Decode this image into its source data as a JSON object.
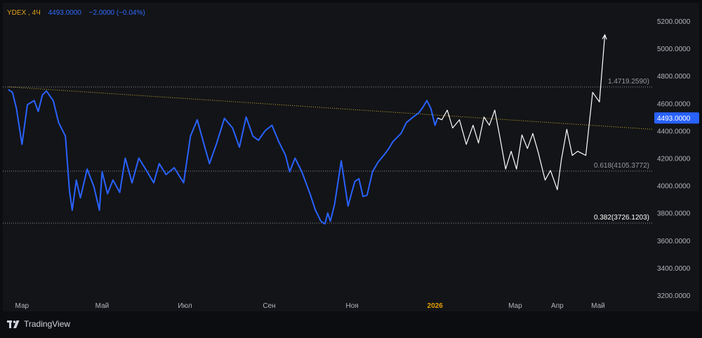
{
  "header": {
    "symbol": "YDEX",
    "timeframe": "4Ч",
    "price": "4493.0000",
    "change": "−2.0000 (−0.04%)"
  },
  "colors": {
    "background": "#0c0d10",
    "plot_background": "#131417",
    "price_line": "#2962ff",
    "projection_line": "#ffffff",
    "trendline": "#c8b632",
    "symbol_text": "#e0a21b",
    "price_text": "#2f6bff",
    "axis_text": "#b2b5be",
    "year_text": "#e5a000",
    "price_tag_bg": "#2962ff"
  },
  "chart_data": {
    "type": "line",
    "title": "",
    "xlabel": "",
    "ylabel": "",
    "ylim": [
      3200,
      5200
    ],
    "y_ticks": [
      "5200.0000",
      "5000.0000",
      "4800.0000",
      "4600.0000",
      "4400.0000",
      "4200.0000",
      "4000.0000",
      "3800.0000",
      "3600.0000",
      "3400.0000",
      "3200.0000"
    ],
    "x_ticks": [
      "Мар",
      "Май",
      "Июл",
      "Сен",
      "Ноя",
      "2026",
      "Мар",
      "Апр",
      "Май"
    ],
    "x_range": [
      "2025-02-20",
      "2026-05-31"
    ],
    "series": [
      {
        "role": "price",
        "x": [
          "2025-02-21",
          "2025-02-24",
          "2025-02-27",
          "2025-03-03",
          "2025-03-07",
          "2025-03-12",
          "2025-03-15",
          "2025-03-18",
          "2025-03-21",
          "2025-03-26",
          "2025-03-30",
          "2025-04-04",
          "2025-04-07",
          "2025-04-09",
          "2025-04-12",
          "2025-04-15",
          "2025-04-20",
          "2025-04-25",
          "2025-04-29",
          "2025-05-01",
          "2025-05-05",
          "2025-05-09",
          "2025-05-14",
          "2025-05-18",
          "2025-05-23",
          "2025-05-28",
          "2025-06-02",
          "2025-06-08",
          "2025-06-12",
          "2025-06-17",
          "2025-06-23",
          "2025-06-30",
          "2025-07-05",
          "2025-07-10",
          "2025-07-15",
          "2025-07-19",
          "2025-07-24",
          "2025-07-30",
          "2025-08-05",
          "2025-08-10",
          "2025-08-15",
          "2025-08-20",
          "2025-08-24",
          "2025-08-29",
          "2025-09-03",
          "2025-09-08",
          "2025-09-13",
          "2025-09-16",
          "2025-09-20",
          "2025-09-25",
          "2025-10-01",
          "2025-10-05",
          "2025-10-09",
          "2025-10-12",
          "2025-10-14",
          "2025-10-16",
          "2025-10-19",
          "2025-10-24",
          "2025-10-29",
          "2025-11-01",
          "2025-11-03",
          "2025-11-06",
          "2025-11-09",
          "2025-11-12",
          "2025-11-16",
          "2025-11-20",
          "2025-11-25",
          "2025-11-28",
          "2025-12-01",
          "2025-12-03",
          "2025-12-07",
          "2025-12-11",
          "2025-12-16",
          "2025-12-20",
          "2025-12-23",
          "2025-12-26",
          "2025-12-29",
          "2026-01-01",
          "2026-01-03"
        ],
        "y": [
          4700,
          4680,
          4560,
          4300,
          4590,
          4620,
          4540,
          4660,
          4690,
          4620,
          4460,
          4360,
          3960,
          3820,
          4040,
          3910,
          4120,
          3990,
          3820,
          4100,
          3940,
          4040,
          3950,
          4200,
          4020,
          4200,
          4120,
          4020,
          4160,
          4080,
          4130,
          4020,
          4360,
          4480,
          4300,
          4160,
          4300,
          4490,
          4420,
          4280,
          4500,
          4360,
          4330,
          4400,
          4440,
          4320,
          4220,
          4100,
          4200,
          4100,
          3940,
          3820,
          3740,
          3720,
          3800,
          3740,
          3860,
          4180,
          3850,
          3960,
          4030,
          4050,
          3920,
          3930,
          4100,
          4170,
          4230,
          4270,
          4320,
          4340,
          4380,
          4460,
          4500,
          4530,
          4570,
          4620,
          4560,
          4440,
          4493
        ]
      },
      {
        "role": "projection",
        "x": [
          "2026-01-03",
          "2026-01-06",
          "2026-01-10",
          "2026-01-14",
          "2026-01-19",
          "2026-01-24",
          "2026-01-29",
          "2026-02-02",
          "2026-02-06",
          "2026-02-10",
          "2026-02-14",
          "2026-02-18",
          "2026-02-22",
          "2026-02-26",
          "2026-03-02",
          "2026-03-06",
          "2026-03-10",
          "2026-03-14",
          "2026-03-18",
          "2026-03-23",
          "2026-03-27",
          "2026-04-01",
          "2026-04-04",
          "2026-04-08",
          "2026-04-12",
          "2026-04-16",
          "2026-04-22",
          "2026-04-27",
          "2026-05-02",
          "2026-05-06"
        ],
        "y": [
          4493,
          4480,
          4550,
          4420,
          4480,
          4300,
          4440,
          4310,
          4500,
          4440,
          4550,
          4340,
          4120,
          4250,
          4120,
          4370,
          4270,
          4380,
          4240,
          4040,
          4110,
          3970,
          4190,
          4410,
          4220,
          4250,
          4220,
          4680,
          4610,
          5100
        ]
      }
    ],
    "annotations": [
      {
        "label": "1.4719.2590)",
        "value": 4719.259
      },
      {
        "label": "0.618(4105.3772)",
        "value": 4105.3772
      },
      {
        "label": "0.382(3726.1203)",
        "value": 3726.1203
      }
    ],
    "trendline": {
      "start": {
        "x": "2025-02-21",
        "y": 4720
      },
      "end": {
        "x": "2026-05-31",
        "y": 4410
      }
    },
    "grid": false,
    "legend": "top-left"
  },
  "footer": {
    "brand": "TradingView",
    "logo": "tradingview-logo-icon"
  }
}
